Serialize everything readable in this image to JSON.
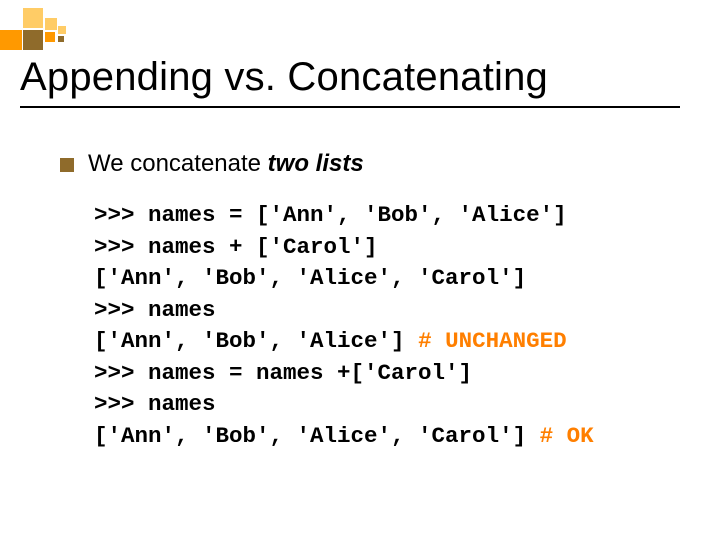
{
  "title": "Appending vs. Concatenating",
  "bullet": {
    "prefix": "We concatenate ",
    "emph": "two lists"
  },
  "code": {
    "l1": ">>> names = ['Ann', 'Bob', 'Alice']",
    "l2": ">>> names + ['Carol']",
    "l3": "['Ann', 'Bob', 'Alice', 'Carol']",
    "l4": ">>> names",
    "l5a": "['Ann', 'Bob', 'Alice'] ",
    "l5b": "# UNCHANGED",
    "l6": ">>> names = names +['Carol']",
    "l7": ">>> names",
    "l8a": "['Ann', 'Bob', 'Alice', 'Carol'] ",
    "l8b": "# OK"
  }
}
